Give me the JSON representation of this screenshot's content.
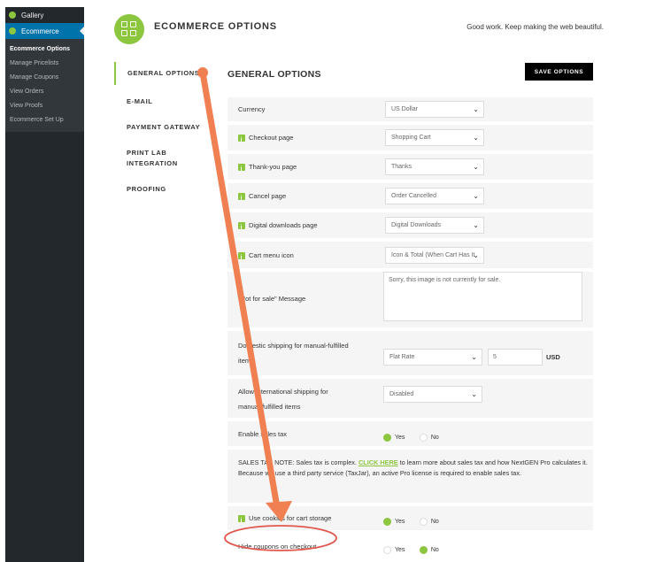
{
  "wp_sidebar": {
    "gallery_label": "Gallery",
    "ecommerce_label": "Ecommerce",
    "submenu": [
      "Ecommerce Options",
      "Manage Pricelists",
      "Manage Coupons",
      "View Orders",
      "View Proofs",
      "Ecommerce Set Up"
    ]
  },
  "header": {
    "title": "ECOMMERCE OPTIONS",
    "tagline": "Good work. Keep making the web beautiful."
  },
  "tabs": [
    "GENERAL OPTIONS",
    "E-MAIL",
    "PAYMENT GATEWAY",
    "PRINT LAB",
    "INTEGRATION",
    "PROOFING"
  ],
  "section_title": "GENERAL OPTIONS",
  "save_label": "SAVE OPTIONS",
  "settings": {
    "currency": {
      "label": "Currency",
      "value": "US Dollar"
    },
    "checkout_page": {
      "label": "Checkout page",
      "value": "Shopping Cart"
    },
    "thankyou_page": {
      "label": "Thank-you page",
      "value": "Thanks"
    },
    "cancel_page": {
      "label": "Cancel page",
      "value": "Order Cancelled"
    },
    "downloads_page": {
      "label": "Digital downloads page",
      "value": "Digital Downloads"
    },
    "cart_icon": {
      "label": "Cart menu icon",
      "value": "Icon & Total (When Cart Has It"
    },
    "not_for_sale": {
      "label": "\"Not for sale\" Message",
      "value": "Sorry, this image is not currently for sale."
    },
    "domestic_shipping": {
      "label_line1": "Domestic shipping for manual-fulfilled",
      "label_line2": "items",
      "method": "Flat Rate",
      "amount": "5",
      "unit": "USD"
    },
    "intl_shipping": {
      "label_line1": "Allow international shipping for",
      "label_line2": "manual-fulfilled items",
      "value": "Disabled"
    },
    "sales_tax": {
      "label": "Enable sales tax",
      "yes": "Yes",
      "no": "No"
    },
    "sales_tax_note": {
      "before": "SALES TAX NOTE: Sales tax is complex. ",
      "link": "CLICK HERE",
      "after": " to learn more about sales tax and how NextGEN Pro calculates it. Because we use a third party service (TaxJar), an active Pro license is required to enable sales tax."
    },
    "cookies": {
      "label": "Use cookies for cart storage",
      "yes": "Yes",
      "no": "No"
    },
    "hide_coupons": {
      "label": "Hide coupons on checkout",
      "yes": "Yes",
      "no": "No"
    }
  },
  "colors": {
    "accent": "#8cc63f",
    "annotation": "#f07f52",
    "wp_sidebar": "#23282d",
    "wp_active": "#0073aa"
  }
}
